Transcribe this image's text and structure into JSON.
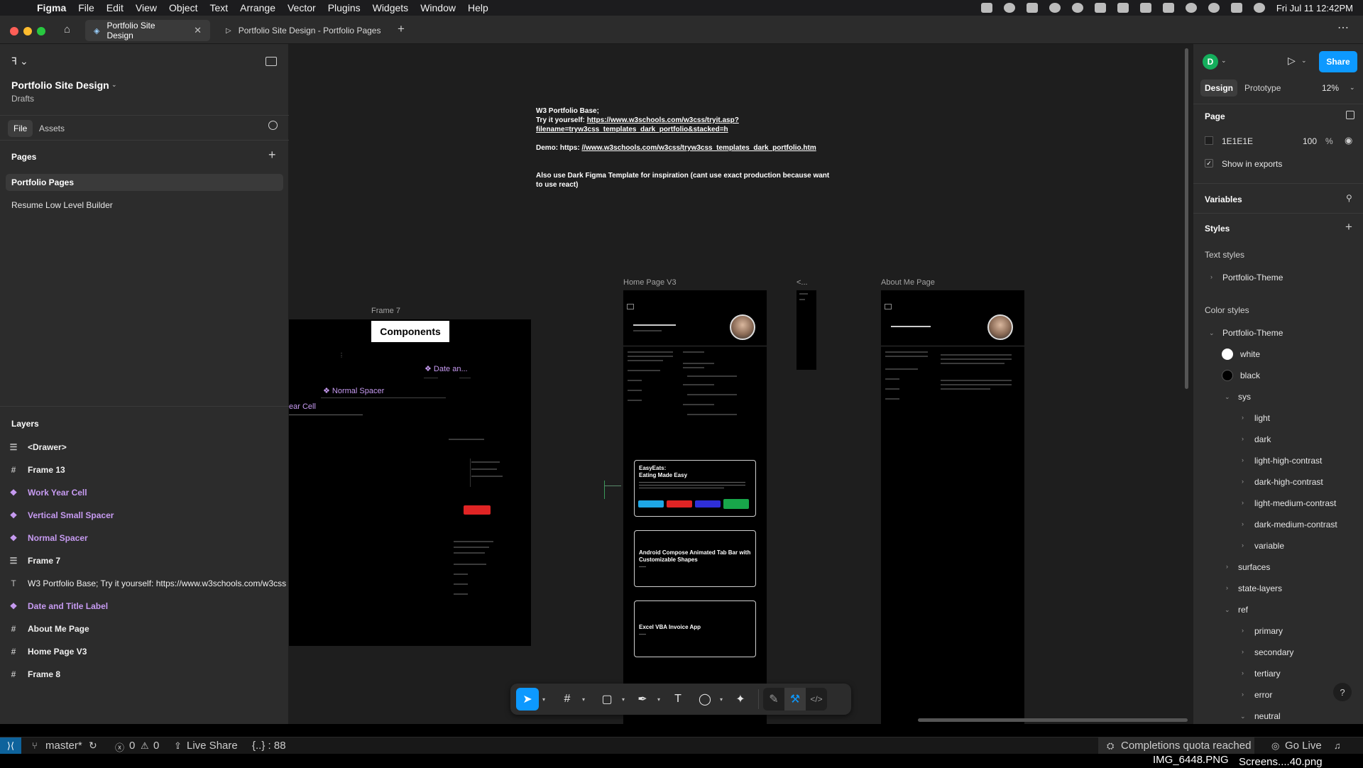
{
  "menubar": {
    "app": "Figma",
    "items": [
      "File",
      "Edit",
      "View",
      "Object",
      "Text",
      "Arrange",
      "Vector",
      "Plugins",
      "Widgets",
      "Window",
      "Help"
    ],
    "datetime": "Fri Jul 11  12:42PM"
  },
  "tabs": [
    {
      "label": "Portfolio Site Design"
    },
    {
      "label": "Portfolio Site Design - Portfolio Pages"
    }
  ],
  "file": {
    "name": "Portfolio Site Design",
    "location": "Drafts"
  },
  "left_tabs": {
    "file": "File",
    "assets": "Assets"
  },
  "pages": {
    "heading": "Pages",
    "items": [
      "Portfolio Pages",
      "Resume Low Level Builder"
    ]
  },
  "layers": {
    "heading": "Layers",
    "items": [
      {
        "label": "<Drawer>",
        "icon": "component-set-icon"
      },
      {
        "label": "Frame 13",
        "icon": "frame-icon"
      },
      {
        "label": "Work Year Cell",
        "icon": "component-icon"
      },
      {
        "label": "Vertical Small Spacer",
        "icon": "component-icon"
      },
      {
        "label": "Normal Spacer",
        "icon": "component-icon"
      },
      {
        "label": "Frame 7",
        "icon": "component-set-icon"
      },
      {
        "label": "W3 Portfolio Base; Try it yourself: https://www.w3schools.com/w3css",
        "icon": "text-icon"
      },
      {
        "label": "Date and Title Label",
        "icon": "component-icon"
      },
      {
        "label": "About Me Page",
        "icon": "frame-icon"
      },
      {
        "label": "Home Page V3",
        "icon": "frame-icon"
      },
      {
        "label": "Frame 8",
        "icon": "frame-icon"
      }
    ]
  },
  "canvas": {
    "note": {
      "line1": "W3 Portfolio Base;",
      "line2_prefix": "Try it yourself: ",
      "line2_link": "https://www.w3schools.com/w3css/tryit.asp?",
      "line3_link": "filename=tryw3css_templates_dark_portfolio&stacked=h",
      "demo_prefix": "Demo: https: ",
      "demo_link": "//www.w3schools.com/w3css/tryw3css_templates_dark_portfolio.htm",
      "inspiration": "Also use Dark Figma Template for inspiration (cant use exact production because want to use react)"
    },
    "frame7": {
      "label": "Frame 7",
      "components_title": "Components",
      "date_label": "Date an...",
      "normal_spacer": "Normal Spacer",
      "year_cell": "ear Cell"
    },
    "home_label": "Home Page V3",
    "small_label": "<...",
    "about_label": "About Me Page",
    "cards": [
      {
        "title": "EasyEats:\nEating Made Easy"
      },
      {
        "title": "Android Compose Animated Tab Bar with Customizable Shapes"
      },
      {
        "title": "Excel VBA Invoice App"
      }
    ]
  },
  "right": {
    "avatar": "D",
    "share": "Share",
    "tabs": {
      "design": "Design",
      "prototype": "Prototype"
    },
    "zoom": "12%",
    "page_heading": "Page",
    "page_color": "1E1E1E",
    "page_opacity": "100",
    "percent": "%",
    "show_exports": "Show in exports",
    "variables": "Variables",
    "styles": "Styles",
    "text_styles": "Text styles",
    "text_style_group": "Portfolio-Theme",
    "color_styles": "Color styles",
    "color_group": "Portfolio-Theme",
    "colors": [
      {
        "name": "white",
        "hex": "#ffffff"
      },
      {
        "name": "black",
        "hex": "#000000"
      }
    ],
    "sys": "sys",
    "sys_items": [
      "light",
      "dark",
      "light-high-contrast",
      "dark-high-contrast",
      "light-medium-contrast",
      "dark-medium-contrast",
      "variable"
    ],
    "surfaces": "surfaces",
    "state_layers": "state-layers",
    "ref": "ref",
    "ref_items": [
      "primary",
      "secondary",
      "tertiary",
      "error",
      "neutral"
    ]
  },
  "statusbar": {
    "branch": "master*",
    "errors": "0",
    "warnings": "0",
    "live_share": "Live Share",
    "braces": "{..} : 88",
    "quota": "Completions quota reached",
    "go_live": "Go Live"
  },
  "bottom": {
    "file1": "IMG_6448.PNG",
    "file2": "Screens....40.png"
  },
  "colors": {
    "accent": "#0d99ff",
    "component": "#c79bf2",
    "avatar": "#14ae5c"
  }
}
